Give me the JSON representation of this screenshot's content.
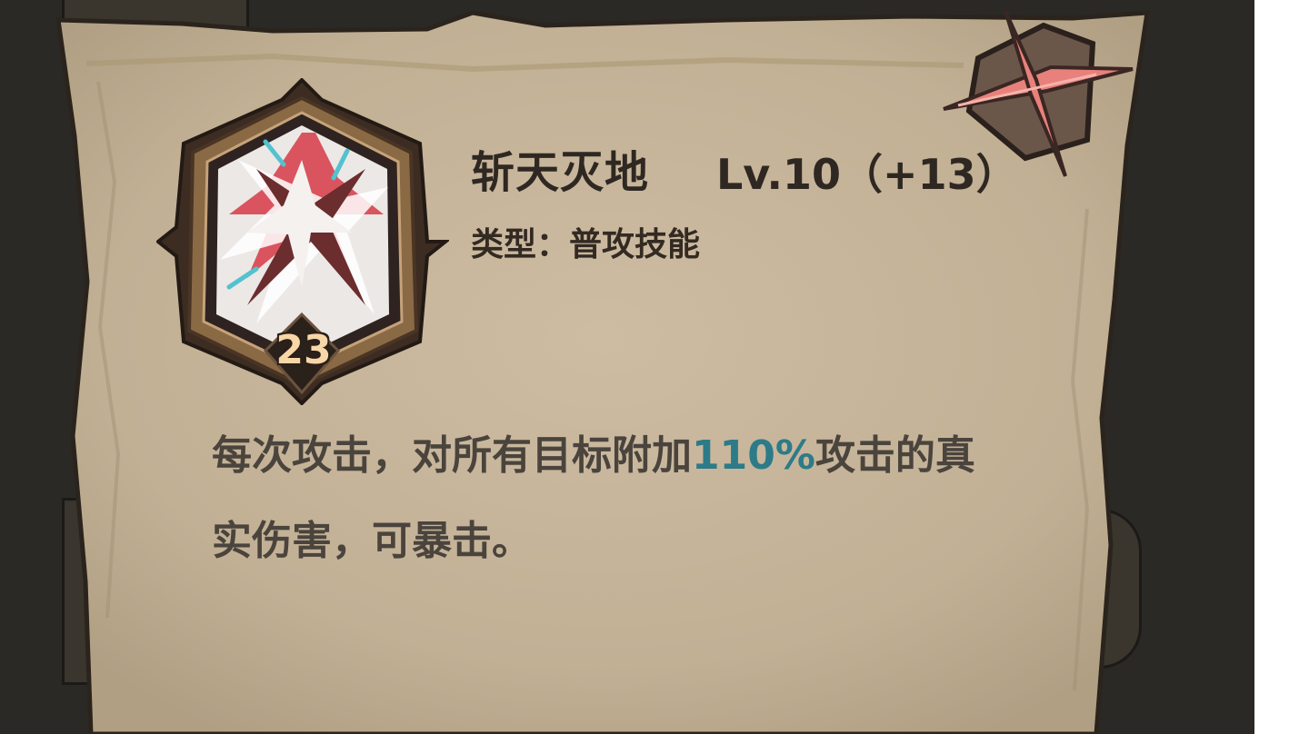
{
  "skill": {
    "name": "斩天灭地",
    "level": "Lv.10（+13）",
    "type": "类型：普攻技能",
    "badge_count": "23",
    "description_before": "每次攻击，对所有目标附加",
    "description_highlight": "110%",
    "description_after": "攻击的真实伤害，可暴击。"
  },
  "icons": {
    "skill": "slash-burst-icon",
    "close": "close-icon"
  },
  "colors": {
    "paper": "#c5b49a",
    "background": "#2b2925",
    "title_text": "#2f2822",
    "desc_text": "#4a443d",
    "highlight": "#2d7b88",
    "badge_text": "#f7d6a8",
    "close_accent": "#e8817b"
  }
}
